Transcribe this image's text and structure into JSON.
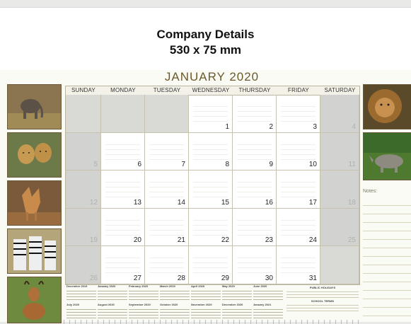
{
  "header": {
    "company_line1": "Company Details",
    "company_line2": "530 x 75 mm"
  },
  "calendar": {
    "month_title": "JANUARY 2020",
    "days": [
      "SUNDAY",
      "MONDAY",
      "TUESDAY",
      "WEDNESDAY",
      "THURSDAY",
      "FRIDAY",
      "SATURDAY"
    ],
    "weeks": [
      [
        "",
        "",
        "",
        "1",
        "2",
        "3",
        "4"
      ],
      [
        "5",
        "6",
        "7",
        "8",
        "9",
        "10",
        "11"
      ],
      [
        "12",
        "13",
        "14",
        "15",
        "16",
        "17",
        "18"
      ],
      [
        "19",
        "20",
        "21",
        "22",
        "23",
        "24",
        "25"
      ],
      [
        "26",
        "27",
        "28",
        "29",
        "30",
        "31",
        ""
      ]
    ]
  },
  "notes": {
    "label": "Notes:"
  },
  "mini_calendars": {
    "row1": [
      "December 2019",
      "January 2020",
      "February 2020",
      "March 2020",
      "April 2020",
      "May 2020",
      "June 2020"
    ],
    "row2": [
      "July 2020",
      "August 2020",
      "September 2020",
      "October 2020",
      "November 2020",
      "December 2020",
      "January 2021"
    ]
  },
  "holidays": {
    "title": "PUBLIC HOLIDAYS",
    "subtitle": "SCHOOL TERMS"
  },
  "photos": [
    "elephant",
    "cheetahs",
    "jackal",
    "zebras",
    "impala",
    "lion",
    "rhino"
  ],
  "colors": {
    "accent": "#6a5a2a",
    "weekend": "#d2d2d0",
    "border": "#b9b59f"
  }
}
